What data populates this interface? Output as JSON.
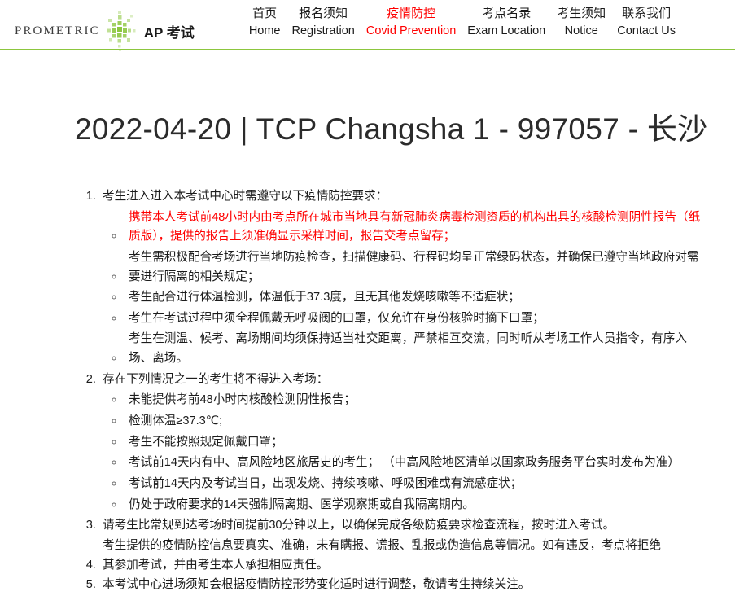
{
  "header": {
    "logo_wordmark": "PROMETRIC",
    "logo_icon": "prometric-starburst-icon",
    "brand_sub": "AP 考试",
    "accent_green": "#8cc63e",
    "alert_red": "#ff0000",
    "nav": [
      {
        "cn": "首页",
        "en": "Home",
        "active": false
      },
      {
        "cn": "报名须知",
        "en": "Registration",
        "active": false
      },
      {
        "cn": "疫情防控",
        "en": "Covid Prevention",
        "active": true
      },
      {
        "cn": "考点名录",
        "en": "Exam Location",
        "active": false
      },
      {
        "cn": "考生须知",
        "en": "Notice",
        "active": false
      },
      {
        "cn": "联系我们",
        "en": "Contact Us",
        "active": false
      }
    ]
  },
  "page": {
    "title": "2022-04-20 | TCP Changsha 1 - 997057 - 长沙"
  },
  "requirements": [
    {
      "text": "考生进入进入本考试中心时需遵守以下疫情防控要求：",
      "sub": [
        {
          "text": "携带本人考试前48小时内由考点所在城市当地具有新冠肺炎病毒检测资质的机构出具的核酸检测阴性报告（纸质版），提供的报告上须准确显示采样时间，报告交考点留存；",
          "warn": true
        },
        {
          "text": "考生需积极配合考场进行当地防疫检查，扫描健康码、行程码均呈正常绿码状态，并确保已遵守当地政府对需要进行隔离的相关规定；",
          "warn": false
        },
        {
          "text": "考生配合进行体温检测，体温低于37.3度，且无其他发烧咳嗽等不适症状；",
          "warn": false
        },
        {
          "text": "考生在考试过程中须全程佩戴无呼吸阀的口罩，仅允许在身份核验时摘下口罩；",
          "warn": false
        },
        {
          "text": "考生在测温、候考、离场期间均须保持适当社交距离，严禁相互交流，同时听从考场工作人员指令，有序入场、离场。",
          "warn": false
        }
      ]
    },
    {
      "text": "存在下列情况之一的考生将不得进入考场：",
      "sub": [
        {
          "text": "未能提供考前48小时内核酸检测阴性报告；",
          "warn": false
        },
        {
          "text": "检测体温≥37.3℃;",
          "warn": false
        },
        {
          "text": "考生不能按照规定佩戴口罩；",
          "warn": false
        },
        {
          "text": "考试前14天内有中、高风险地区旅居史的考生； （中高风险地区清单以国家政务服务平台实时发布为准）",
          "warn": false
        },
        {
          "text": "考试前14天内及考试当日，出现发烧、持续咳嗽、呼吸困难或有流感症状；",
          "warn": false
        },
        {
          "text": "仍处于政府要求的14天强制隔离期、医学观察期或自我隔离期内。",
          "warn": false
        }
      ]
    },
    {
      "text": "请考生比常规到达考场时间提前30分钟以上，以确保完成各级防疫要求检查流程，按时进入考试。",
      "sub": []
    },
    {
      "text": "考生提供的疫情防控信息要真实、准确，未有瞒报、谎报、乱报或伪造信息等情况。如有违反，考点将拒绝其参加考试，并由考生本人承担相应责任。",
      "sub": []
    },
    {
      "text": "本考试中心进场须知会根据疫情防控形势变化适时进行调整，敬请考生持续关注。",
      "sub": []
    }
  ]
}
